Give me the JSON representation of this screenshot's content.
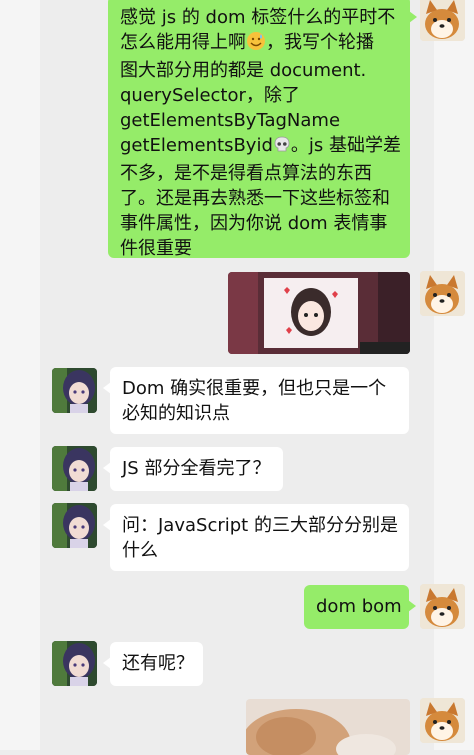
{
  "messages": [
    {
      "side": "right",
      "kind": "text",
      "lines": [
        "感觉 js 的 dom 标签什么的平时不",
        "怎么能用得上啊",
        "，我写个轮播",
        "图大部分用的都是 document.",
        "querySelector，除了",
        "getElementsByTagName",
        "getElementsByid",
        "。js 基础学差",
        "不多，是不是得看点算法的东西",
        "了。还是再去熟悉一下这些标签和",
        "事件属性，因为你说 dom 表情事",
        "件很重要"
      ],
      "emoji_1": "sweat-smile-emoji",
      "emoji_2": "skull-emoji"
    },
    {
      "side": "right",
      "kind": "image",
      "icon": "photo-anime-drawing"
    },
    {
      "side": "left",
      "kind": "text",
      "lines": [
        "Dom 确实很重要，但也只是一个",
        "必知的知识点"
      ]
    },
    {
      "side": "left",
      "kind": "text",
      "lines": [
        "JS 部分全看完了？"
      ]
    },
    {
      "side": "left",
      "kind": "text",
      "lines": [
        "问：JavaScript 的三大部分分别是",
        "什么"
      ]
    },
    {
      "side": "right",
      "kind": "text",
      "lines": [
        "dom bom"
      ]
    },
    {
      "side": "left",
      "kind": "text",
      "lines": [
        "还有呢？"
      ]
    },
    {
      "side": "right",
      "kind": "image",
      "icon": "photo-dog-closeup"
    }
  ],
  "colors": {
    "background": "#ededed",
    "bubble_self": "#95ec69",
    "bubble_other": "#ffffff"
  },
  "avatars": {
    "self": "shiba-dog-avatar",
    "other": "anime-girl-avatar"
  }
}
